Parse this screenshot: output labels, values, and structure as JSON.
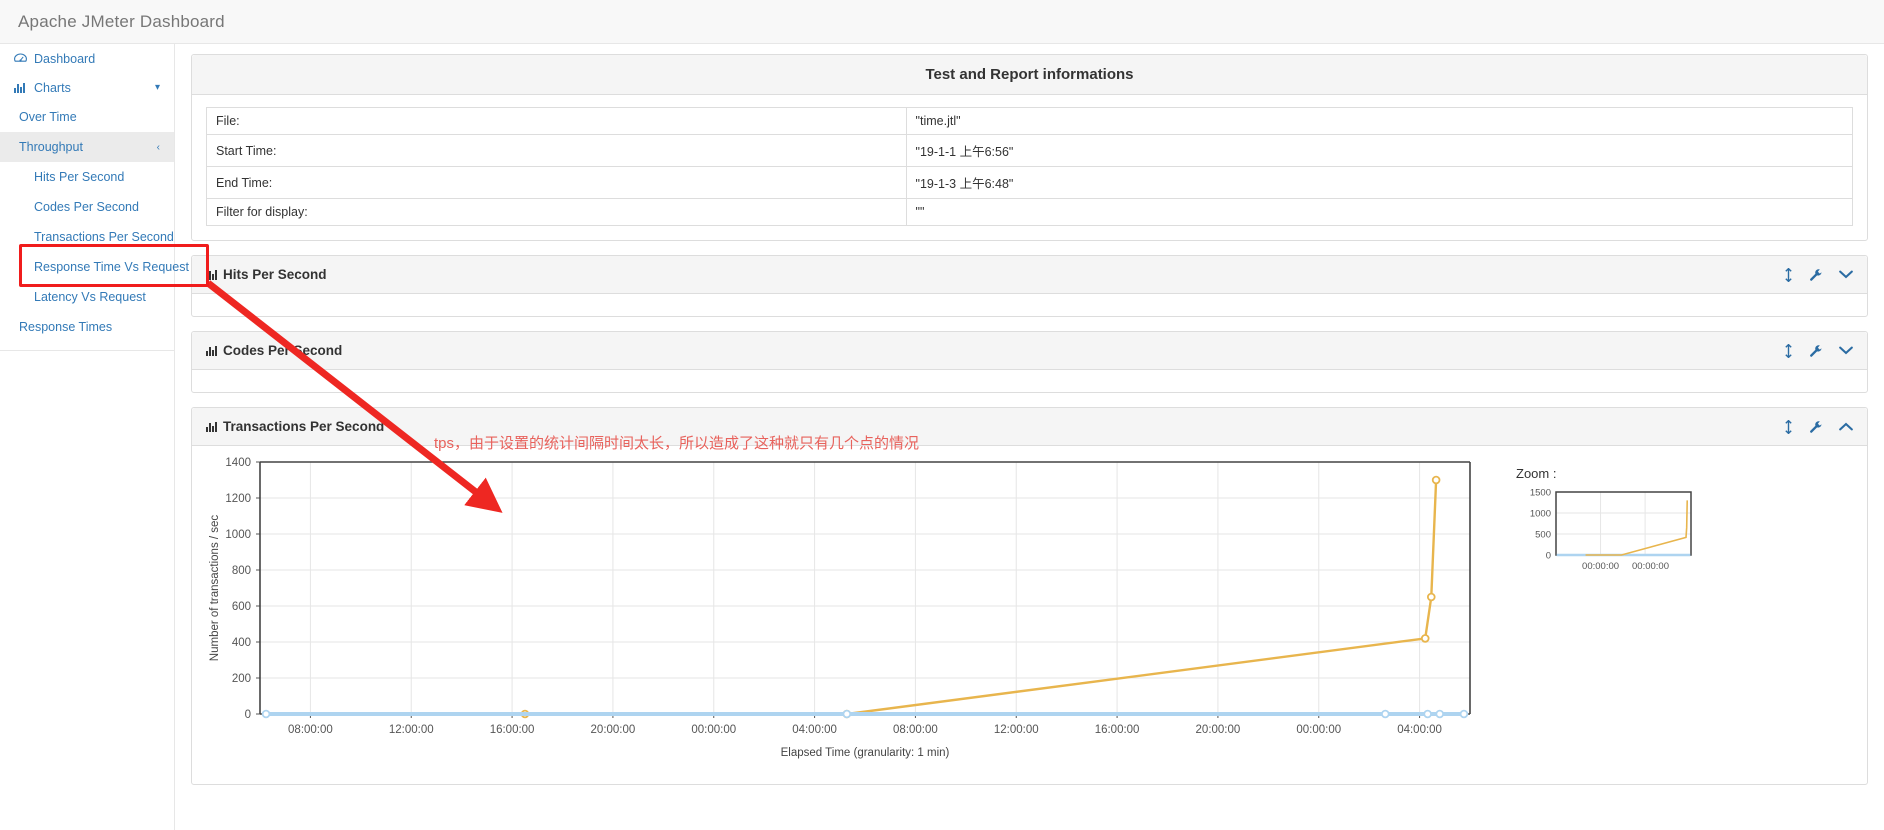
{
  "app": {
    "title": "Apache JMeter Dashboard"
  },
  "sidebar": {
    "items": [
      {
        "label": "Dashboard",
        "icon": "dashboard-gauge-icon",
        "level": 0,
        "caret": ""
      },
      {
        "label": "Charts",
        "icon": "bar-chart-icon",
        "level": 0,
        "caret": "chevron-down"
      },
      {
        "label": "Over Time",
        "icon": "",
        "level": 1,
        "caret": ""
      },
      {
        "label": "Throughput",
        "icon": "",
        "level": 1,
        "caret": "chevron-left"
      },
      {
        "label": "Hits Per Second",
        "icon": "",
        "level": 2,
        "caret": ""
      },
      {
        "label": "Codes Per Second",
        "icon": "",
        "level": 2,
        "caret": ""
      },
      {
        "label": "Transactions Per Second",
        "icon": "",
        "level": 2,
        "caret": ""
      },
      {
        "label": "Response Time Vs Request",
        "icon": "",
        "level": 2,
        "caret": ""
      },
      {
        "label": "Latency Vs Request",
        "icon": "",
        "level": 2,
        "caret": ""
      },
      {
        "label": "Response Times",
        "icon": "",
        "level": 1,
        "caret": ""
      }
    ]
  },
  "info_panel": {
    "title": "Test and Report informations",
    "rows": [
      {
        "key": "File:",
        "value": "\"time.jtl\""
      },
      {
        "key": "Start Time:",
        "value": "\"19-1-1 上午6:56\""
      },
      {
        "key": "End Time:",
        "value": "\"19-1-3 上午6:48\""
      },
      {
        "key": "Filter for display:",
        "value": "\"\""
      }
    ]
  },
  "panels": [
    {
      "title": "Hits Per Second",
      "icon": "bar-chart-icon",
      "collapse_icon": "chevron-down-icon",
      "expanded": false
    },
    {
      "title": "Codes Per Second",
      "icon": "bar-chart-icon",
      "collapse_icon": "chevron-down-icon",
      "expanded": false
    },
    {
      "title": "Transactions Per Second",
      "icon": "bar-chart-icon",
      "collapse_icon": "chevron-up-icon",
      "expanded": true
    }
  ],
  "panel_tools": {
    "resize": "resize-vertical-icon",
    "settings": "wrench-icon"
  },
  "annotation": {
    "text": "tps，由于设置的统计间隔时间太长，所以造成了这种就只有几个点的情况",
    "color": "#e8625c"
  },
  "zoom_panel": {
    "label": "Zoom :",
    "y_ticks": [
      "1500",
      "1000",
      "500",
      "0"
    ],
    "x_ticks": [
      "00:00:00",
      "00:00:00"
    ]
  },
  "colors": {
    "link": "#337ab7",
    "series_orange": "#e8b54d",
    "series_blue": "#aed4f0",
    "highlight_red": "#f01c1c",
    "panel_header": "#f5f5f5",
    "border": "#dddddd"
  },
  "chart_data": {
    "type": "line",
    "title": "Transactions Per Second",
    "xlabel": "Elapsed Time (granularity: 1 min)",
    "ylabel": "Number of transactions / sec",
    "ylim": [
      0,
      1400
    ],
    "y_ticks": [
      0,
      200,
      400,
      600,
      800,
      1000,
      1200,
      1400
    ],
    "x_ticks": [
      "08:00:00",
      "12:00:00",
      "16:00:00",
      "20:00:00",
      "00:00:00",
      "04:00:00",
      "08:00:00",
      "12:00:00",
      "16:00:00",
      "20:00:00",
      "00:00:00",
      "04:00:00"
    ],
    "grid": true,
    "legend": "none",
    "series": [
      {
        "name": "transactions-orange",
        "color": "#e8b54d",
        "points": [
          {
            "x": 21.9,
            "y": 0
          },
          {
            "x": 48.5,
            "y": 0
          },
          {
            "x": 96.3,
            "y": 420
          },
          {
            "x": 96.8,
            "y": 650
          },
          {
            "x": 97.2,
            "y": 1300
          }
        ]
      },
      {
        "name": "baseline-blue",
        "color": "#aed4f0",
        "points": [
          {
            "x": 0.5,
            "y": 0
          },
          {
            "x": 48.5,
            "y": 0
          },
          {
            "x": 93.0,
            "y": 0
          },
          {
            "x": 96.5,
            "y": 0
          },
          {
            "x": 97.5,
            "y": 0
          },
          {
            "x": 99.5,
            "y": 0
          }
        ]
      }
    ]
  }
}
